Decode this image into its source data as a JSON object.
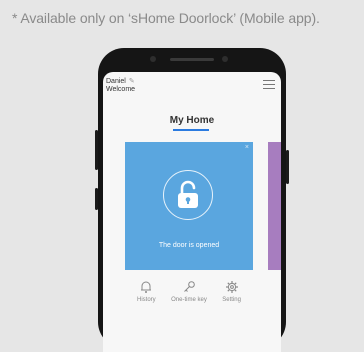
{
  "caption": "* Available only on ‘sHome Doorlock’ (Mobile app).",
  "app": {
    "user_name": "Daniel",
    "greeting": "Welcome",
    "home_title": "My Home",
    "door_status": "The door is opened",
    "card_close": "×",
    "accent_color": "#2b7be0",
    "card_color": "#5aa6df",
    "strip_color": "#a77dbf",
    "actions": [
      {
        "label": "History",
        "icon": "bell-icon"
      },
      {
        "label": "One-time key",
        "icon": "key-icon"
      },
      {
        "label": "Setting",
        "icon": "gear-icon"
      }
    ]
  }
}
